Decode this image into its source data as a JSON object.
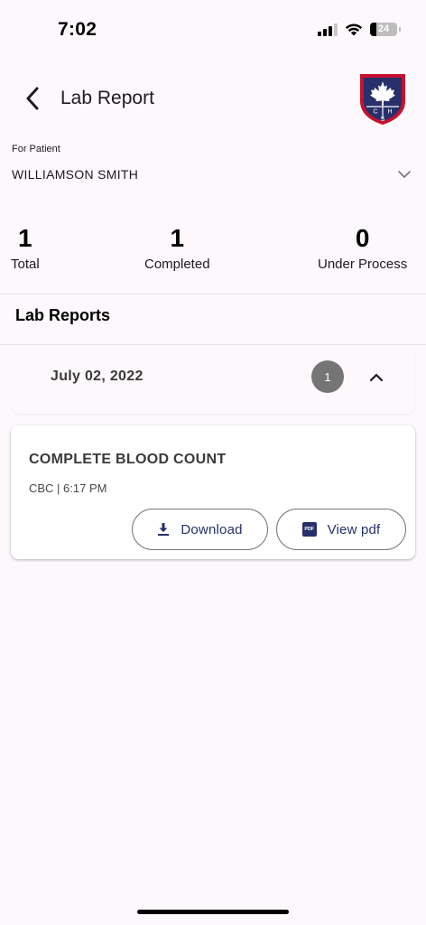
{
  "status_bar": {
    "time": "7:02",
    "battery": "24",
    "battery_level": 0.24
  },
  "app_bar": {
    "title": "Lab Report",
    "logo_letters": [
      "C",
      "H",
      "S"
    ]
  },
  "patient": {
    "label": "For Patient",
    "name": "WILLIAMSON SMITH"
  },
  "stats": [
    {
      "value": "1",
      "label": "Total"
    },
    {
      "value": "1",
      "label": "Completed"
    },
    {
      "value": "0",
      "label": "Under Process"
    }
  ],
  "section_title": "Lab Reports",
  "groups": [
    {
      "date": "July 02, 2022",
      "count": "1",
      "expanded": true,
      "reports": [
        {
          "title": "COMPLETE BLOOD COUNT",
          "meta": "CBC | 6:17 PM",
          "download_label": "Download",
          "view_label": "View pdf",
          "pdf_icon_text": "PDF"
        }
      ]
    }
  ],
  "colors": {
    "background": "#fcf8fc",
    "accent": "#27306b",
    "badge": "#757575",
    "logo_blue": "#27306b",
    "logo_red": "#c8102e"
  }
}
